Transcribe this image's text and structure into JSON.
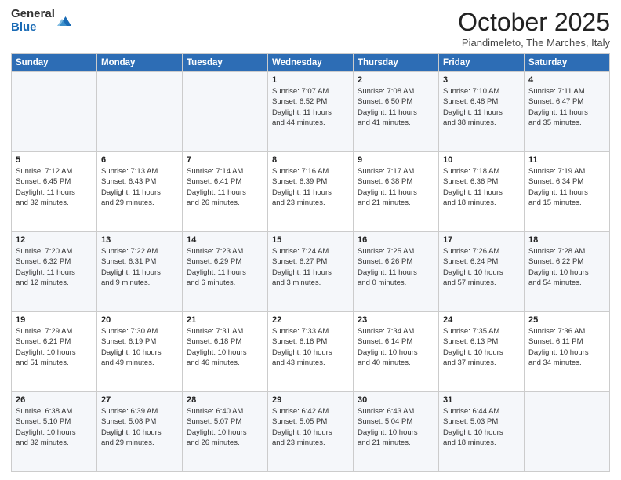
{
  "logo": {
    "general": "General",
    "blue": "Blue"
  },
  "header": {
    "month": "October 2025",
    "location": "Piandimeleto, The Marches, Italy"
  },
  "weekdays": [
    "Sunday",
    "Monday",
    "Tuesday",
    "Wednesday",
    "Thursday",
    "Friday",
    "Saturday"
  ],
  "weeks": [
    [
      {
        "day": "",
        "info": ""
      },
      {
        "day": "",
        "info": ""
      },
      {
        "day": "",
        "info": ""
      },
      {
        "day": "1",
        "info": "Sunrise: 7:07 AM\nSunset: 6:52 PM\nDaylight: 11 hours\nand 44 minutes."
      },
      {
        "day": "2",
        "info": "Sunrise: 7:08 AM\nSunset: 6:50 PM\nDaylight: 11 hours\nand 41 minutes."
      },
      {
        "day": "3",
        "info": "Sunrise: 7:10 AM\nSunset: 6:48 PM\nDaylight: 11 hours\nand 38 minutes."
      },
      {
        "day": "4",
        "info": "Sunrise: 7:11 AM\nSunset: 6:47 PM\nDaylight: 11 hours\nand 35 minutes."
      }
    ],
    [
      {
        "day": "5",
        "info": "Sunrise: 7:12 AM\nSunset: 6:45 PM\nDaylight: 11 hours\nand 32 minutes."
      },
      {
        "day": "6",
        "info": "Sunrise: 7:13 AM\nSunset: 6:43 PM\nDaylight: 11 hours\nand 29 minutes."
      },
      {
        "day": "7",
        "info": "Sunrise: 7:14 AM\nSunset: 6:41 PM\nDaylight: 11 hours\nand 26 minutes."
      },
      {
        "day": "8",
        "info": "Sunrise: 7:16 AM\nSunset: 6:39 PM\nDaylight: 11 hours\nand 23 minutes."
      },
      {
        "day": "9",
        "info": "Sunrise: 7:17 AM\nSunset: 6:38 PM\nDaylight: 11 hours\nand 21 minutes."
      },
      {
        "day": "10",
        "info": "Sunrise: 7:18 AM\nSunset: 6:36 PM\nDaylight: 11 hours\nand 18 minutes."
      },
      {
        "day": "11",
        "info": "Sunrise: 7:19 AM\nSunset: 6:34 PM\nDaylight: 11 hours\nand 15 minutes."
      }
    ],
    [
      {
        "day": "12",
        "info": "Sunrise: 7:20 AM\nSunset: 6:32 PM\nDaylight: 11 hours\nand 12 minutes."
      },
      {
        "day": "13",
        "info": "Sunrise: 7:22 AM\nSunset: 6:31 PM\nDaylight: 11 hours\nand 9 minutes."
      },
      {
        "day": "14",
        "info": "Sunrise: 7:23 AM\nSunset: 6:29 PM\nDaylight: 11 hours\nand 6 minutes."
      },
      {
        "day": "15",
        "info": "Sunrise: 7:24 AM\nSunset: 6:27 PM\nDaylight: 11 hours\nand 3 minutes."
      },
      {
        "day": "16",
        "info": "Sunrise: 7:25 AM\nSunset: 6:26 PM\nDaylight: 11 hours\nand 0 minutes."
      },
      {
        "day": "17",
        "info": "Sunrise: 7:26 AM\nSunset: 6:24 PM\nDaylight: 10 hours\nand 57 minutes."
      },
      {
        "day": "18",
        "info": "Sunrise: 7:28 AM\nSunset: 6:22 PM\nDaylight: 10 hours\nand 54 minutes."
      }
    ],
    [
      {
        "day": "19",
        "info": "Sunrise: 7:29 AM\nSunset: 6:21 PM\nDaylight: 10 hours\nand 51 minutes."
      },
      {
        "day": "20",
        "info": "Sunrise: 7:30 AM\nSunset: 6:19 PM\nDaylight: 10 hours\nand 49 minutes."
      },
      {
        "day": "21",
        "info": "Sunrise: 7:31 AM\nSunset: 6:18 PM\nDaylight: 10 hours\nand 46 minutes."
      },
      {
        "day": "22",
        "info": "Sunrise: 7:33 AM\nSunset: 6:16 PM\nDaylight: 10 hours\nand 43 minutes."
      },
      {
        "day": "23",
        "info": "Sunrise: 7:34 AM\nSunset: 6:14 PM\nDaylight: 10 hours\nand 40 minutes."
      },
      {
        "day": "24",
        "info": "Sunrise: 7:35 AM\nSunset: 6:13 PM\nDaylight: 10 hours\nand 37 minutes."
      },
      {
        "day": "25",
        "info": "Sunrise: 7:36 AM\nSunset: 6:11 PM\nDaylight: 10 hours\nand 34 minutes."
      }
    ],
    [
      {
        "day": "26",
        "info": "Sunrise: 6:38 AM\nSunset: 5:10 PM\nDaylight: 10 hours\nand 32 minutes."
      },
      {
        "day": "27",
        "info": "Sunrise: 6:39 AM\nSunset: 5:08 PM\nDaylight: 10 hours\nand 29 minutes."
      },
      {
        "day": "28",
        "info": "Sunrise: 6:40 AM\nSunset: 5:07 PM\nDaylight: 10 hours\nand 26 minutes."
      },
      {
        "day": "29",
        "info": "Sunrise: 6:42 AM\nSunset: 5:05 PM\nDaylight: 10 hours\nand 23 minutes."
      },
      {
        "day": "30",
        "info": "Sunrise: 6:43 AM\nSunset: 5:04 PM\nDaylight: 10 hours\nand 21 minutes."
      },
      {
        "day": "31",
        "info": "Sunrise: 6:44 AM\nSunset: 5:03 PM\nDaylight: 10 hours\nand 18 minutes."
      },
      {
        "day": "",
        "info": ""
      }
    ]
  ]
}
